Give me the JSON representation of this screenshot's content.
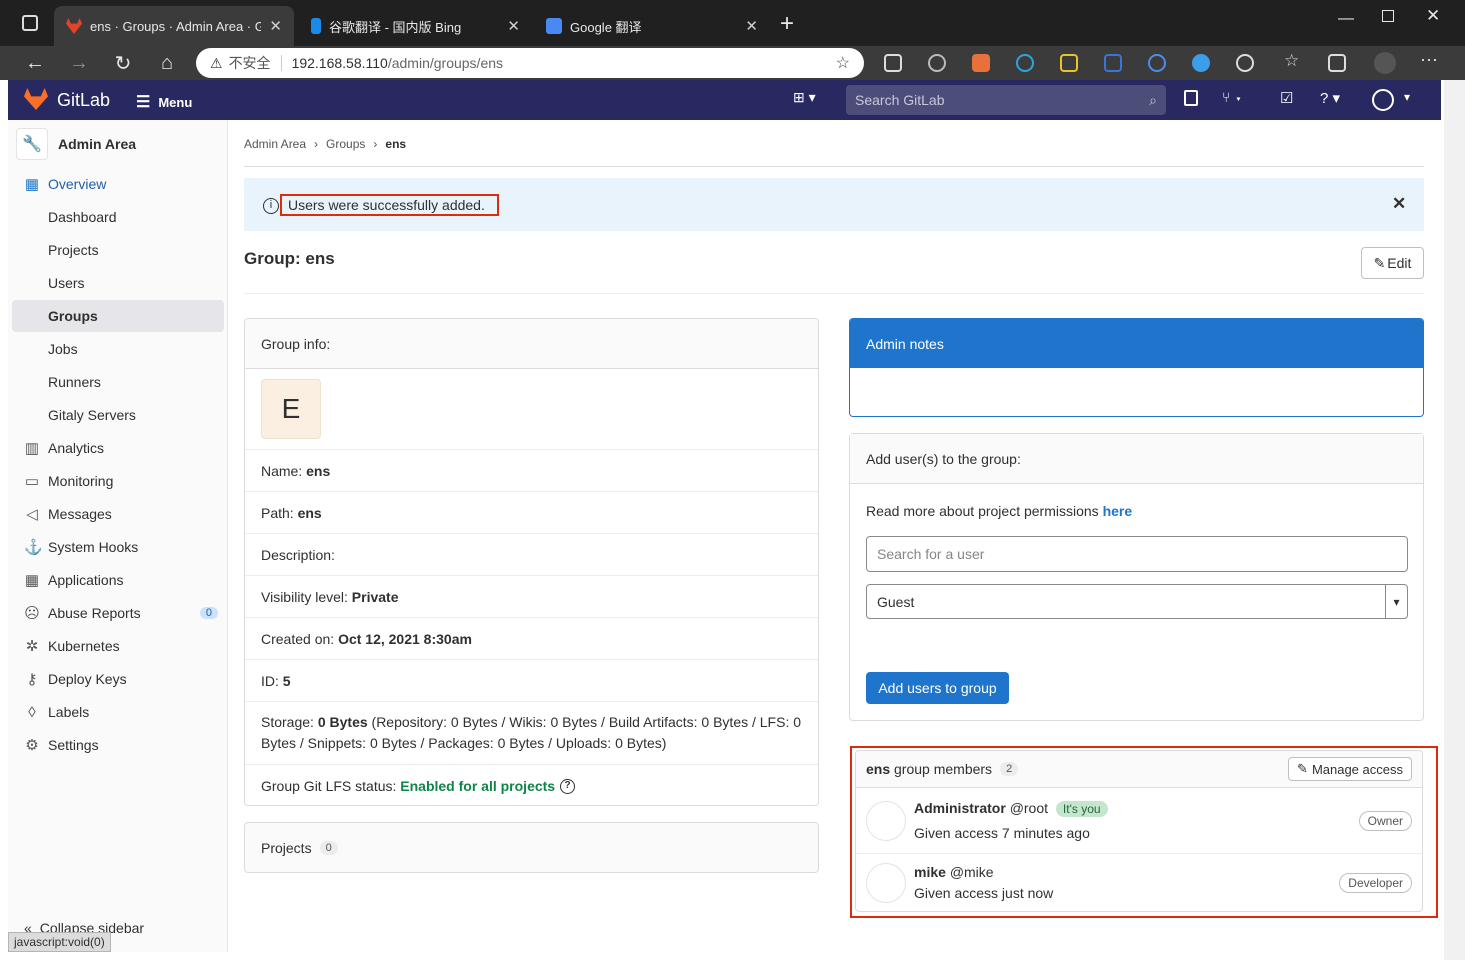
{
  "browser": {
    "tabs": [
      {
        "title": "ens · Groups · Admin Area · GitLa",
        "active": true
      },
      {
        "title": "谷歌翻译 - 国内版 Bing",
        "active": false
      },
      {
        "title": "Google 翻译",
        "active": false
      }
    ],
    "security_label": "不安全",
    "url_host": "192.168.58.110",
    "url_path": "/admin/groups/ens"
  },
  "header": {
    "brand": "GitLab",
    "menu_label": "Menu",
    "search_placeholder": "Search GitLab"
  },
  "sidebar": {
    "title": "Admin Area",
    "items": [
      {
        "label": "Overview",
        "icon": "overview-icon",
        "kind": "section",
        "active": true
      },
      {
        "label": "Dashboard",
        "kind": "sub"
      },
      {
        "label": "Projects",
        "kind": "sub"
      },
      {
        "label": "Users",
        "kind": "sub"
      },
      {
        "label": "Groups",
        "kind": "sub",
        "active": true
      },
      {
        "label": "Jobs",
        "kind": "sub"
      },
      {
        "label": "Runners",
        "kind": "sub"
      },
      {
        "label": "Gitaly Servers",
        "kind": "sub"
      },
      {
        "label": "Analytics",
        "icon": "chart-icon",
        "kind": "section"
      },
      {
        "label": "Monitoring",
        "icon": "monitor-icon",
        "kind": "section"
      },
      {
        "label": "Messages",
        "icon": "bullhorn-icon",
        "kind": "section"
      },
      {
        "label": "System Hooks",
        "icon": "hook-icon",
        "kind": "section"
      },
      {
        "label": "Applications",
        "icon": "grid-icon",
        "kind": "section"
      },
      {
        "label": "Abuse Reports",
        "icon": "abuse-icon",
        "kind": "section",
        "badge": "0"
      },
      {
        "label": "Kubernetes",
        "icon": "kubernetes-icon",
        "kind": "section"
      },
      {
        "label": "Deploy Keys",
        "icon": "key-icon",
        "kind": "section"
      },
      {
        "label": "Labels",
        "icon": "label-icon",
        "kind": "section"
      },
      {
        "label": "Settings",
        "icon": "gear-icon",
        "kind": "section"
      }
    ],
    "collapse_label": "Collapse sidebar"
  },
  "status_bar": "javascript:void(0)",
  "breadcrumb": [
    "Admin Area",
    "Groups",
    "ens"
  ],
  "flash": "Users were successfully added.",
  "page_title": "Group: ens",
  "edit_label": "Edit",
  "group_info": {
    "header": "Group info:",
    "avatar_letter": "E",
    "name_label": "Name:",
    "name_value": "ens",
    "path_label": "Path:",
    "path_value": "ens",
    "description_label": "Description:",
    "visibility_label": "Visibility level:",
    "visibility_value": "Private",
    "created_label": "Created on:",
    "created_value": "Oct 12, 2021 8:30am",
    "id_label": "ID:",
    "id_value": "5",
    "storage_label": "Storage:",
    "storage_value": "0 Bytes",
    "storage_detail_1": "(Repository: 0 Bytes / Wikis: 0 Bytes / Build Artifacts: 0 Bytes / LFS: 0",
    "storage_detail_2": "Bytes / Snippets: 0 Bytes / Packages: 0 Bytes / Uploads: 0 Bytes)",
    "lfs_label": "Group Git LFS status:",
    "lfs_value": "Enabled for all projects"
  },
  "projects": {
    "label": "Projects",
    "count": "0"
  },
  "admin_notes": {
    "header": "Admin notes"
  },
  "add_users": {
    "header": "Add user(s) to the group:",
    "read_more": "Read more about project permissions",
    "read_more_link": "here",
    "search_placeholder": "Search for a user",
    "role_selected": "Guest",
    "submit_label": "Add users to group"
  },
  "members": {
    "group_name": "ens",
    "title_suffix": "group members",
    "count": "2",
    "manage_label": "Manage access",
    "list": [
      {
        "name": "Administrator",
        "username": "@root",
        "tag": "It's you",
        "access": "Given access 7 minutes ago",
        "role": "Owner"
      },
      {
        "name": "mike",
        "username": "@mike",
        "tag": "",
        "access": "Given access just now",
        "role": "Developer"
      }
    ]
  },
  "colors": {
    "header_bg": "#292961",
    "primary": "#1f75cb",
    "flash_bg": "#e9f3fc",
    "highlight_box": "#dd2b0e",
    "success": "#108548"
  }
}
